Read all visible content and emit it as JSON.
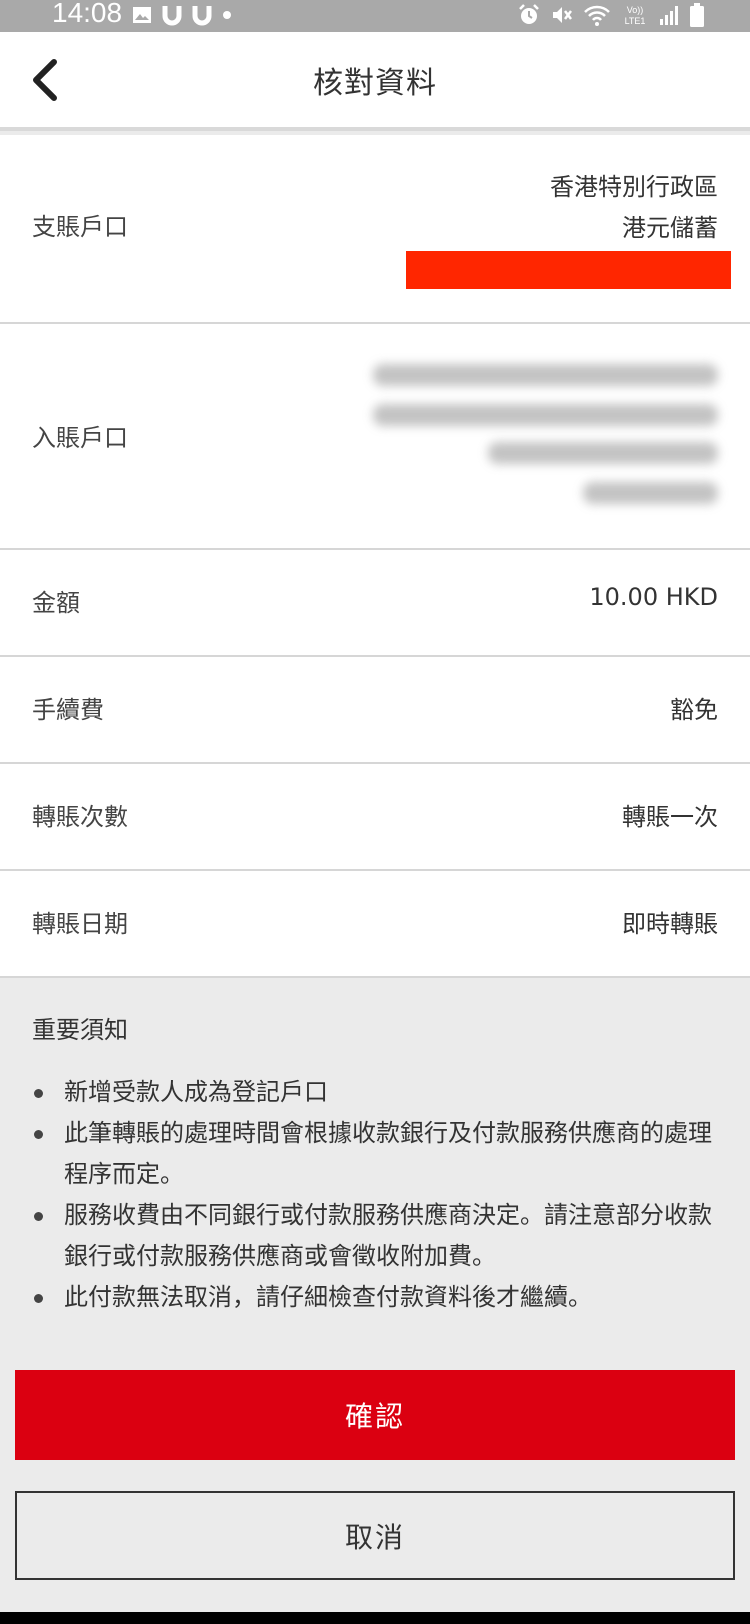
{
  "status_bar": {
    "time": "14:08",
    "left_icons": [
      "gallery-icon",
      "magnet-icon",
      "magnet-icon",
      "dot-icon"
    ],
    "right_icons": [
      "alarm-icon",
      "mute-icon",
      "wifi-icon",
      "volte-icon",
      "signal-icon",
      "battery-icon"
    ]
  },
  "header": {
    "title": "核對資料",
    "back_icon": "chevron-left-icon"
  },
  "rows": {
    "from_account": {
      "label": "支賬戶口",
      "line1": "香港特別行政區",
      "line2": "港元儲蓄"
    },
    "to_account": {
      "label": "入賬戶口"
    },
    "amount": {
      "label": "金額",
      "value": "10.00 HKD"
    },
    "fee": {
      "label": "手續費",
      "value": "豁免"
    },
    "frequency": {
      "label": "轉賬次數",
      "value": "轉賬一次"
    },
    "date": {
      "label": "轉賬日期",
      "value": "即時轉賬"
    }
  },
  "notice": {
    "title": "重要須知",
    "items": [
      "新增受款人成為登記戶口",
      "此筆轉賬的處理時間會根據收款銀行及付款服務供應商的處理程序而定。",
      "服務收費由不同銀行或付款服務供應商決定。請注意部分收款銀行或付款服務供應商或會徵收附加費。",
      "此付款無法取消，請仔細檢查付款資料後才繼續。"
    ]
  },
  "buttons": {
    "confirm": "確認",
    "cancel": "取消"
  },
  "colors": {
    "brand_red": "#db0011",
    "redaction": "#ff2600",
    "background": "#ebebeb"
  }
}
